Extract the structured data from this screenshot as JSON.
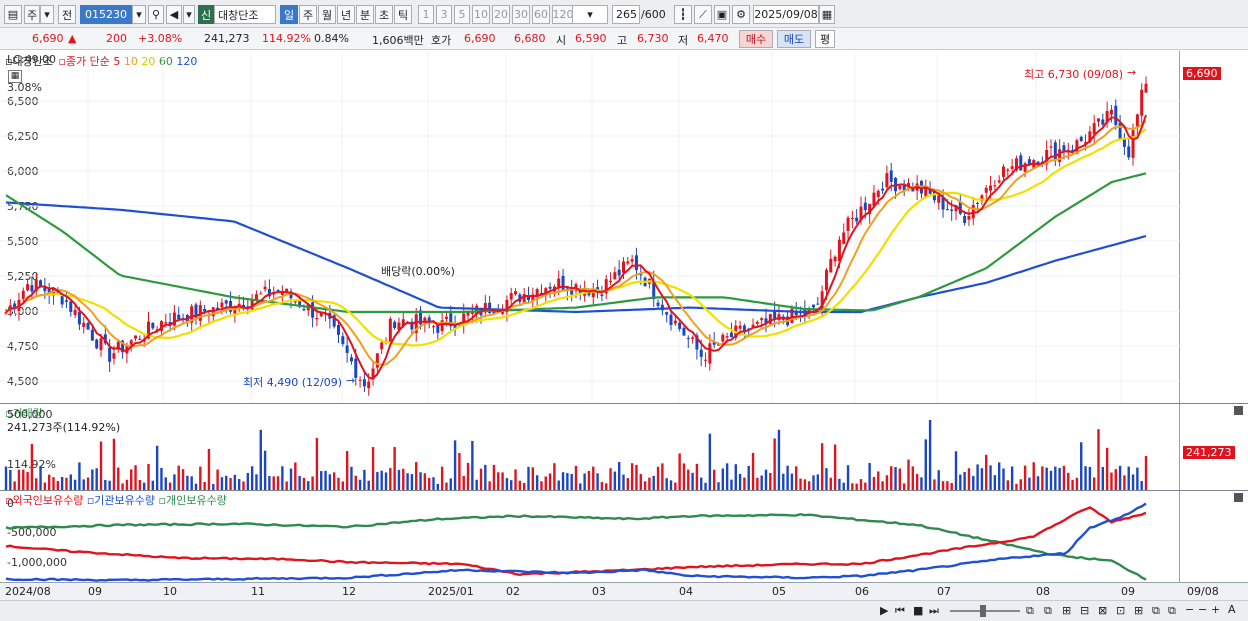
{
  "toolbar": {
    "market": "주",
    "prev": "전",
    "code": "015230",
    "new_badge": "신",
    "stock_name": "대창단조",
    "periods": [
      "일",
      "주",
      "월",
      "년",
      "분",
      "초",
      "틱"
    ],
    "intervals": [
      "1",
      "3",
      "5",
      "10",
      "20",
      "30",
      "60",
      "120"
    ],
    "count": "265",
    "count_max": "/600",
    "date": "2025/09/08"
  },
  "quote": {
    "price": "6,690",
    "change_arrow": "▲",
    "change": "200",
    "change_pct": "+3.08%",
    "volume": "241,273",
    "volume_ratio": "114.92%",
    "turnover": "0.84%",
    "amount": "1,606백만",
    "bid_label": "호가",
    "ask": "6,690",
    "bid": "6,680",
    "open_label": "시",
    "open": "6,590",
    "high_label": "고",
    "high": "6,730",
    "low_label": "저",
    "low": "6,470",
    "buy": "매수",
    "sell": "매도",
    "eval": "평"
  },
  "price_pane": {
    "stock": "대창단조",
    "ma_label": "종가 단순",
    "ma_periods": [
      "5",
      "10",
      "20",
      "60",
      "120"
    ],
    "ma_colors": [
      "#e0141e",
      "#f0a020",
      "#f0e000",
      "#2e9a3e",
      "#2050d0"
    ],
    "lc": "LC:49,00",
    "price_badge": "6,690",
    "pct_badge": "3.08%",
    "max_label": "최고 6,730 (09/08)",
    "min_label": "최저 4,490 (12/09)",
    "dividend_label": "배당락(0.00%)",
    "y_ticks": [
      "6,500",
      "6,250",
      "6,000",
      "5,750",
      "5,500",
      "5,250",
      "5,000",
      "4,750",
      "4,500"
    ]
  },
  "volume_pane": {
    "title": "거래량",
    "value": "241,273주(114.92%)",
    "y_tick": "500,000",
    "badge": "241,273",
    "ratio": "114.92%"
  },
  "holding_pane": {
    "series": [
      "외국인보유수량",
      "기관보유수량",
      "개인보유수량"
    ],
    "colors": [
      "#e0141e",
      "#2050d0",
      "#2e8a4e"
    ],
    "y_ticks": [
      "0",
      "-500,000",
      "-1,000,000"
    ]
  },
  "xaxis": {
    "labels": [
      "2024/08",
      "09",
      "10",
      "11",
      "12",
      "2025/01",
      "02",
      "03",
      "04",
      "05",
      "06",
      "07",
      "08",
      "09"
    ],
    "right_label": "09/08"
  }
}
